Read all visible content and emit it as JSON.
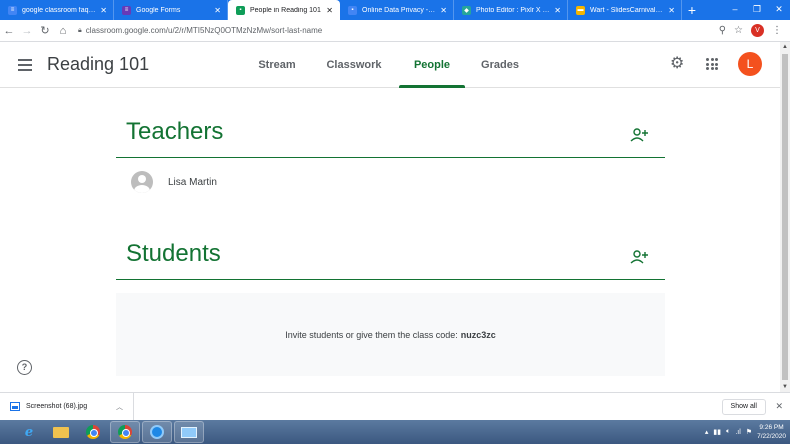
{
  "browser": {
    "tabs": [
      {
        "title": "google classroom faqs -",
        "icon": "docs-icon",
        "color": "#4285f4"
      },
      {
        "title": "Google Forms",
        "icon": "forms-icon",
        "color": "#673ab7"
      },
      {
        "title": "People in Reading 101",
        "icon": "classroom-icon",
        "color": "#0f9d58",
        "active": true
      },
      {
        "title": "Online Data Privacy - Go",
        "icon": "sites-icon",
        "color": "#4285f4"
      },
      {
        "title": "Photo Editor : Pixlr X - fr",
        "icon": "pixlr-icon",
        "color": "#26a69a"
      },
      {
        "title": "Wart - SlidesCarnival - G",
        "icon": "slides-icon",
        "color": "#f4b400"
      }
    ],
    "new_tab": "+",
    "url": "classroom.google.com/u/2/r/MTI5NzQ0OTMzNzMw/sort-last-name",
    "profile_initial": "V"
  },
  "classroom": {
    "class_name": "Reading 101",
    "tabs": [
      "Stream",
      "Classwork",
      "People",
      "Grades"
    ],
    "active_tab": "People",
    "avatar_initial": "L",
    "accent": "#137333"
  },
  "people": {
    "teachers_heading": "Teachers",
    "teachers": [
      {
        "name": "Lisa Martin"
      }
    ],
    "students_heading": "Students",
    "invite_text": "Invite students or give them the class code:",
    "class_code": "nuzc3zc"
  },
  "downloads": {
    "file_name": "Screenshot (68).jpg",
    "show_all": "Show all"
  },
  "taskbar": {
    "time": "9:26 PM",
    "date": "7/22/2020"
  }
}
